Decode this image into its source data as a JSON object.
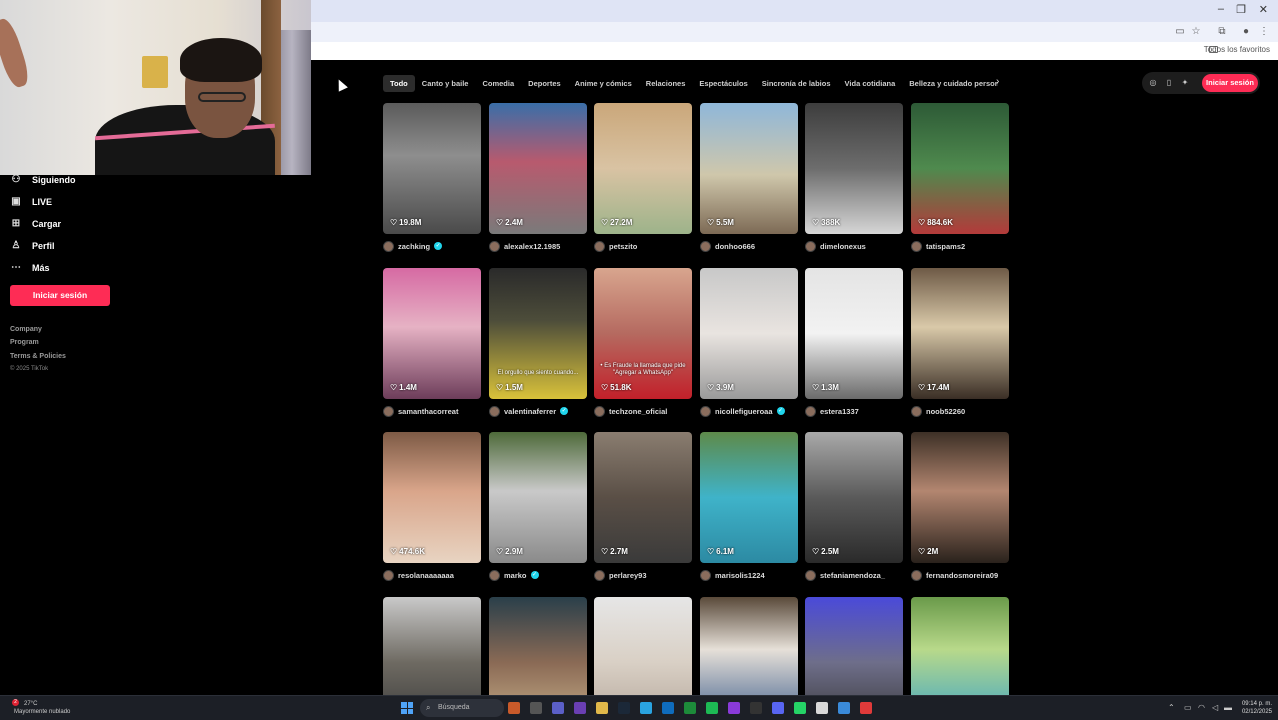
{
  "colors": {
    "accent": "#fe2c55",
    "verified": "#20d5ec",
    "background": "#000000"
  },
  "browser": {
    "bookmarks_label": "Todos los favoritos",
    "window_controls": [
      "–",
      "❐",
      "✕"
    ]
  },
  "sidebar": {
    "items": [
      {
        "label": "Siguiendo",
        "icon": "following-icon"
      },
      {
        "label": "LIVE",
        "icon": "live-icon"
      },
      {
        "label": "Cargar",
        "icon": "upload-icon"
      },
      {
        "label": "Perfil",
        "icon": "profile-icon"
      },
      {
        "label": "Más",
        "icon": "more-icon"
      }
    ],
    "login_button": "Iniciar sesión",
    "footer": [
      "Company",
      "Program",
      "Terms & Policies"
    ],
    "copyright": "© 2025 TikTok"
  },
  "tabs": [
    "Todo",
    "Canto y baile",
    "Comedia",
    "Deportes",
    "Anime y cómics",
    "Relaciones",
    "Espectáculos",
    "Sincronía de labios",
    "Vida cotidiana",
    "Belleza y cuidado personal"
  ],
  "header": {
    "login_button": "Iniciar sesión"
  },
  "videos": [
    {
      "likes": "19.8M",
      "user": "zachking",
      "verified": true,
      "bg": "linear-gradient(180deg,#5b5b5b,#8e8e8e 40%,#4a4a4a)",
      "text": ""
    },
    {
      "likes": "2.4M",
      "user": "alexalex12.1985",
      "verified": false,
      "bg": "linear-gradient(180deg,#3a6ea8,#b85a6e 45%,#7a7a7a)",
      "text": ""
    },
    {
      "likes": "27.2M",
      "user": "petszito",
      "verified": false,
      "bg": "linear-gradient(180deg,#caa77a,#d9c3a3 50%,#9db38a)",
      "text": ""
    },
    {
      "likes": "5.5M",
      "user": "donhoo666",
      "verified": false,
      "bg": "linear-gradient(180deg,#8fb7d9,#cfc7ab 55%,#7d6a55)",
      "text": ""
    },
    {
      "likes": "388K",
      "user": "dimelonexus",
      "verified": false,
      "bg": "linear-gradient(180deg,#3d3d3d,#6d6d6d 50%,#d6d6d6)",
      "text": ""
    },
    {
      "likes": "884.6K",
      "user": "tatispams2",
      "verified": false,
      "bg": "linear-gradient(180deg,#2d5a36,#4f8a4e 50%,#b33a3a)",
      "text": ""
    },
    {
      "likes": "1.4M",
      "user": "samanthacorreat",
      "verified": false,
      "bg": "linear-gradient(180deg,#d66aa3,#e6b2c4 45%,#6d3d5a)",
      "text": ""
    },
    {
      "likes": "1.5M",
      "user": "valentinaferrer",
      "verified": true,
      "bg": "linear-gradient(180deg,#2a2a2a,#4d4d3a 40%,#d9c23a)",
      "text": "El orgullo que siento cuando..."
    },
    {
      "likes": "51.8K",
      "user": "techzone_oficial",
      "verified": false,
      "bg": "linear-gradient(180deg,#d8a58e,#b56a60 50%,#c2202a)",
      "text": "• Es Fraude la llamada que pide \"Agregar a WhatsApp\""
    },
    {
      "likes": "3.9M",
      "user": "nicollefigueroaa",
      "verified": true,
      "bg": "linear-gradient(180deg,#c8c8c8,#e9e4e0 50%,#9a9a9a)",
      "text": ""
    },
    {
      "likes": "1.3M",
      "user": "estera1337",
      "verified": false,
      "bg": "linear-gradient(180deg,#e4e4e4,#f2f2f2 50%,#6b6b6b)",
      "text": ""
    },
    {
      "likes": "17.4M",
      "user": "noob52260",
      "verified": false,
      "bg": "linear-gradient(180deg,#6e5a46,#d9c9a9 45%,#3a2e25)",
      "text": ""
    },
    {
      "likes": "474.6K",
      "user": "resolanaaaaaaa",
      "verified": false,
      "bg": "linear-gradient(180deg,#7d5a45,#d9a58a 45%,#e8d4c2)",
      "text": ""
    },
    {
      "likes": "2.9M",
      "user": "marko",
      "verified": true,
      "bg": "linear-gradient(180deg,#4e6a3a,#c9c9c9 45%,#8a8a8a)",
      "text": ""
    },
    {
      "likes": "2.7M",
      "user": "perlarey93",
      "verified": false,
      "bg": "linear-gradient(180deg,#8a7d70,#5a4f46 50%,#3a3a3a)",
      "text": ""
    },
    {
      "likes": "6.1M",
      "user": "marisolis1224",
      "verified": false,
      "bg": "linear-gradient(180deg,#5e8a4a,#3fb3c9 50%,#2c8aa3)",
      "text": ""
    },
    {
      "likes": "2.5M",
      "user": "stefaniamendoza_",
      "verified": false,
      "bg": "linear-gradient(180deg,#a9a9a9,#5a5a5a 50%,#2a2a2a)",
      "text": ""
    },
    {
      "likes": "2M",
      "user": "fernandosmoreira09",
      "verified": false,
      "bg": "linear-gradient(180deg,#3d3026,#b38670 45%,#2a221c)",
      "text": ""
    },
    {
      "likes": "",
      "user": "",
      "verified": false,
      "bg": "linear-gradient(180deg,#c9c9c9,#6e6a62 50%,#3a3a3a)",
      "text": ""
    },
    {
      "likes": "",
      "user": "",
      "verified": false,
      "bg": "linear-gradient(180deg,#2a3f4a,#8a6a55 50%,#c9b08a)",
      "text": ""
    },
    {
      "likes": "",
      "user": "",
      "verified": false,
      "bg": "linear-gradient(180deg,#e6e6e6,#d9d0c5 50%,#b3a59a)",
      "text": ""
    },
    {
      "likes": "",
      "user": "",
      "verified": false,
      "bg": "linear-gradient(180deg,#5a4a3a,#e6e0d8 40%,#3a5a8a)",
      "text": ""
    },
    {
      "likes": "",
      "user": "",
      "verified": false,
      "bg": "linear-gradient(180deg,#4a4ad9,#6e6e8a 50%,#3a3a3a)",
      "text": ""
    },
    {
      "likes": "",
      "user": "",
      "verified": false,
      "bg": "linear-gradient(180deg,#6a9a4a,#b8d98a 40%,#3aa3c9)",
      "text": ""
    }
  ],
  "taskbar": {
    "weather_temp": "27°C",
    "weather_desc": "Mayormente nublado",
    "notification_count": "2",
    "search_placeholder": "Búsqueda",
    "time": "09:14 p. m.",
    "date": "02/12/2025"
  }
}
